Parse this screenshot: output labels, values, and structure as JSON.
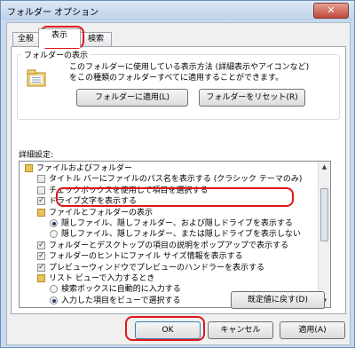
{
  "window": {
    "title": "フォルダー オプション",
    "close_symbol": "✕"
  },
  "tabs": [
    {
      "label": "全般"
    },
    {
      "label": "表示"
    },
    {
      "label": "検索"
    }
  ],
  "folder_view": {
    "group_title": "フォルダーの表示",
    "description_line1": "このフォルダーに使用している表示方法 (詳細表示やアイコンなど)",
    "description_line2": "をこの種類のフォルダーすべてに適用することができます。",
    "apply_button": "フォルダーに適用(L)",
    "reset_button": "フォルダーをリセット(R)"
  },
  "advanced": {
    "label": "詳細設定:",
    "items": [
      {
        "kind": "folder",
        "indent": 0,
        "text": "ファイルおよびフォルダー"
      },
      {
        "kind": "checkbox",
        "indent": 1,
        "checked": false,
        "text": "タイトル バーにファイルのパス名を表示する (クラシック テーマのみ)"
      },
      {
        "kind": "checkbox",
        "indent": 1,
        "checked": false,
        "text": "チェックボックスを使用して項目を選択する"
      },
      {
        "kind": "checkbox",
        "indent": 1,
        "checked": true,
        "text": "ドライブ文字を表示する"
      },
      {
        "kind": "folder",
        "indent": 1,
        "text": "ファイルとフォルダーの表示"
      },
      {
        "kind": "radio",
        "indent": 2,
        "checked": true,
        "text": "隠しファイル、隠しフォルダー、および隠しドライブを表示する"
      },
      {
        "kind": "radio",
        "indent": 2,
        "checked": false,
        "text": "隠しファイル、隠しフォルダー、または隠しドライブを表示しない"
      },
      {
        "kind": "checkbox",
        "indent": 1,
        "checked": true,
        "text": "フォルダーとデスクトップの項目の説明をポップアップで表示する"
      },
      {
        "kind": "checkbox",
        "indent": 1,
        "checked": true,
        "text": "フォルダーのヒントにファイル サイズ情報を表示する"
      },
      {
        "kind": "checkbox",
        "indent": 1,
        "checked": true,
        "text": "プレビューウィンドウでプレビューのハンドラーを表示する"
      },
      {
        "kind": "folder",
        "indent": 1,
        "text": "リスト ビューで入力するとき"
      },
      {
        "kind": "radio",
        "indent": 2,
        "checked": false,
        "text": "検索ボックスに自動的に入力する"
      },
      {
        "kind": "radio",
        "indent": 2,
        "checked": true,
        "text": "入力した項目をビューで選択する"
      }
    ],
    "restore_button": "既定値に戻す(D)"
  },
  "footer": {
    "ok_button": "OK",
    "cancel_button": "キャンセル",
    "apply_button": "適用(A)"
  },
  "highlight_color": "#e0161a"
}
